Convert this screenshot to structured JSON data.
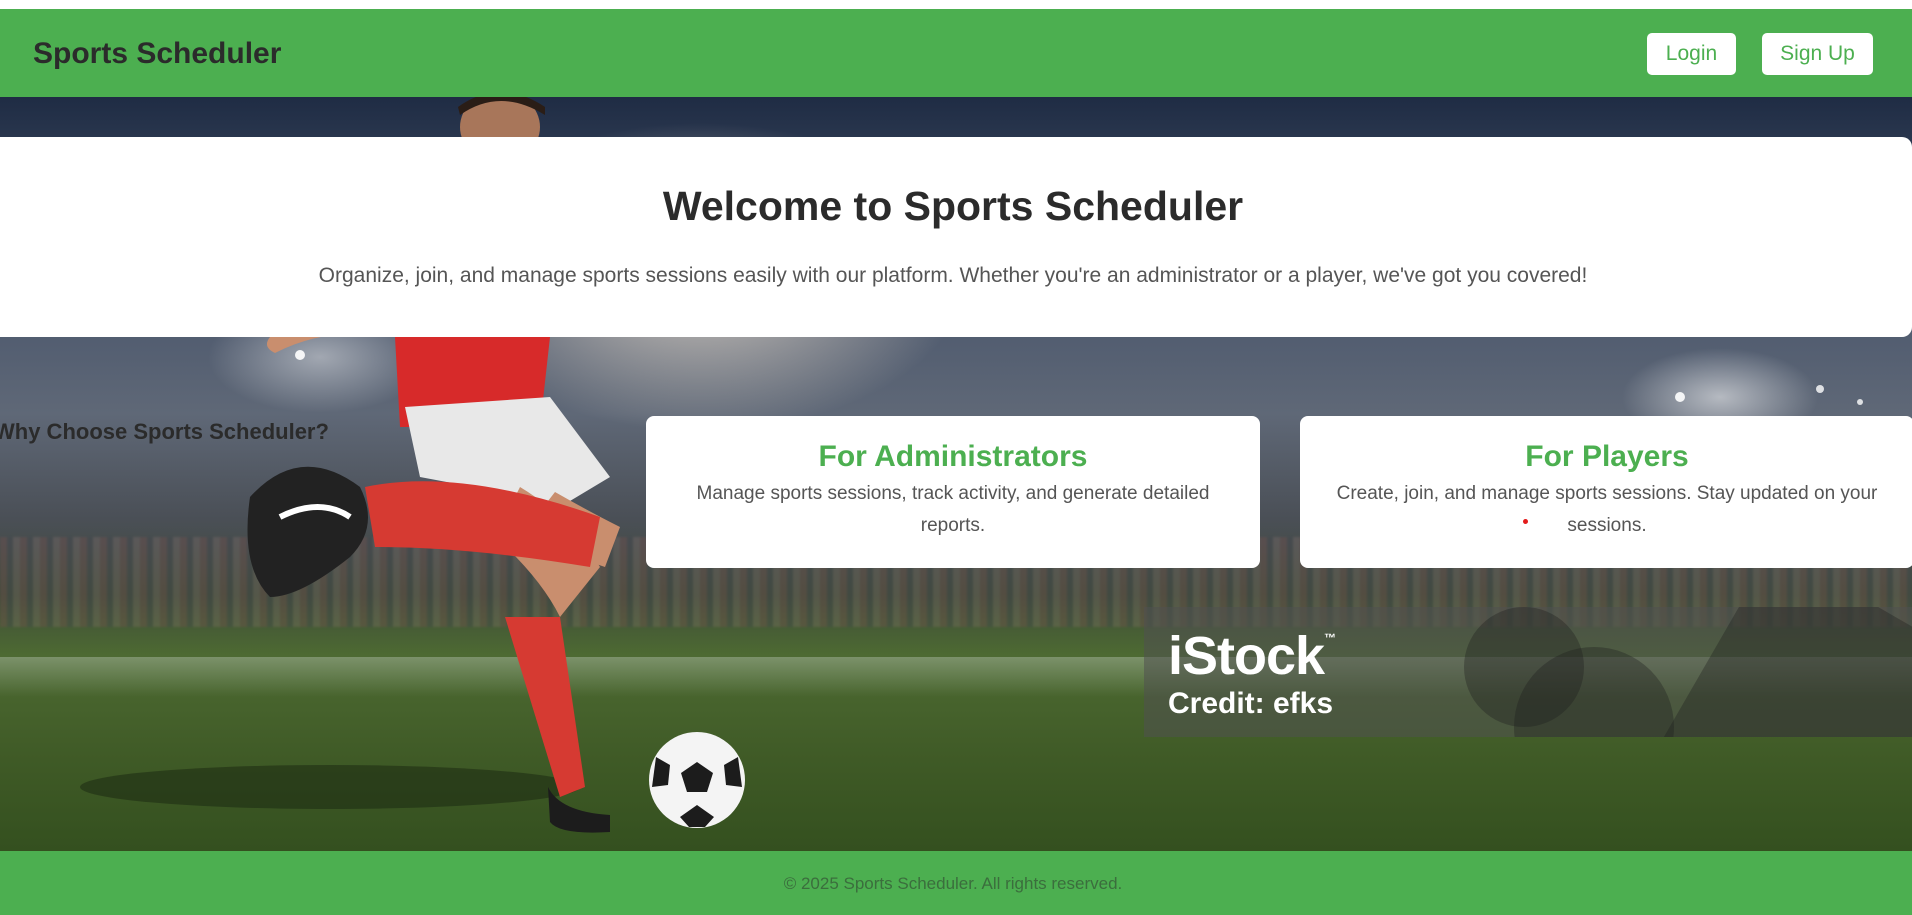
{
  "navbar": {
    "brand": "Sports Scheduler",
    "login_label": "Login",
    "signup_label": "Sign Up"
  },
  "welcome": {
    "title": "Welcome to Sports Scheduler",
    "text": "Organize, join, and manage sports sessions easily with our platform. Whether you're an administrator or a player, we've got you covered!"
  },
  "features": {
    "heading": "Why Choose Sports Scheduler?",
    "cards": [
      {
        "title": "For Administrators",
        "text": "Manage sports sessions, track activity, and generate detailed reports."
      },
      {
        "title": "For Players",
        "text": "Create, join, and manage sports sessions. Stay updated on your sessions."
      }
    ]
  },
  "watermark": {
    "logo": "iStock",
    "trademark": "™",
    "credit": "Credit: efks"
  },
  "footer": {
    "text": "© 2025 Sports Scheduler. All rights reserved."
  },
  "colors": {
    "brand_green": "#4caf50",
    "heading_dark": "#2b2b2b",
    "body_gray": "#555555",
    "card_white": "#ffffff"
  },
  "icons": {
    "hero_image": "soccer-player-kicking-ball-image"
  }
}
